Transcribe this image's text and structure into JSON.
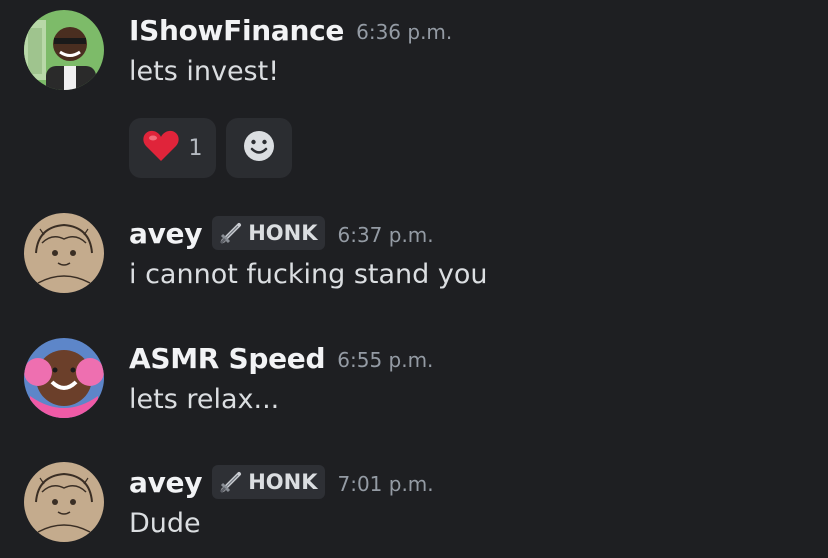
{
  "messages": [
    {
      "username": "IShowFinance",
      "time": "6:36 p.m.",
      "content": "lets invest!",
      "avatar": "money-avatar",
      "reactions": [
        {
          "emoji": "heart-emoji",
          "count": "1"
        }
      ]
    },
    {
      "username": "avey",
      "tag": "HONK",
      "tag_icon": "sword-icon",
      "time": "6:37 p.m.",
      "content": "i cannot fucking stand you",
      "avatar": "sketch-avatar"
    },
    {
      "username": "ASMR Speed",
      "time": "6:55 p.m.",
      "content": "lets relax...",
      "avatar": "headphones-avatar"
    },
    {
      "username": "avey",
      "tag": "HONK",
      "tag_icon": "sword-icon",
      "time": "7:01 p.m.",
      "content": "Dude",
      "avatar": "sketch-avatar"
    }
  ],
  "colors": {
    "background": "#1e1f22",
    "username": "#f2f3f5",
    "text": "#dbdee1",
    "timestamp": "#949ba4",
    "chip": "#2b2d31"
  }
}
